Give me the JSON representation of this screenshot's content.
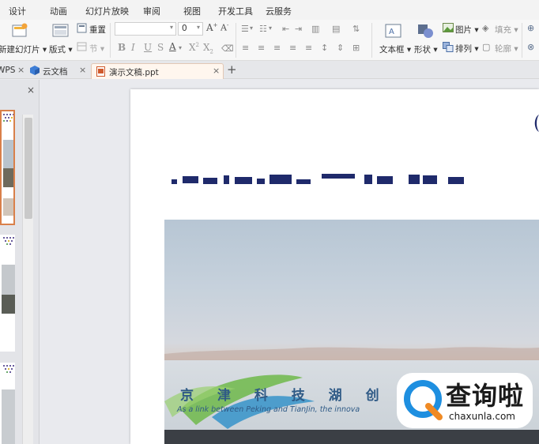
{
  "menu": {
    "items": [
      "设计",
      "动画",
      "幻灯片放映",
      "审阅",
      "视图",
      "开发工具",
      "云服务"
    ]
  },
  "ribbon": {
    "new_slide_label": "新建幻灯片",
    "layout_label": "版式",
    "reset_label": "重置",
    "section_label": "节",
    "font_size_value": "0",
    "textbox_label": "文本框",
    "shape_label": "形状",
    "picture_label": "图片",
    "arrange_label": "排列",
    "fill_label": "填充",
    "outline_label": "轮廓",
    "font_size_up_icon": "font-size-increase-icon",
    "font_size_down_icon": "font-size-decrease-icon"
  },
  "tabs": [
    {
      "label": "WPS",
      "icon": "wps-icon",
      "active": false
    },
    {
      "label": "云文档",
      "icon": "cloud-doc-icon",
      "active": false
    },
    {
      "label": "演示文稿.ppt",
      "icon": "ppt-file-icon",
      "active": true
    }
  ],
  "slide": {
    "photo_sign_cn": "京 津 科 技 湖  创",
    "photo_sign_en": "As a link between Peking and TianJin,  the innova"
  },
  "watermark": {
    "text": "查询啦",
    "url": "chaxunla.com"
  },
  "colors": {
    "accent_orange": "#d9804a",
    "title_navy": "#1f2a6b",
    "watermark_blue": "#1e8fe0",
    "watermark_orange": "#f08a24"
  }
}
